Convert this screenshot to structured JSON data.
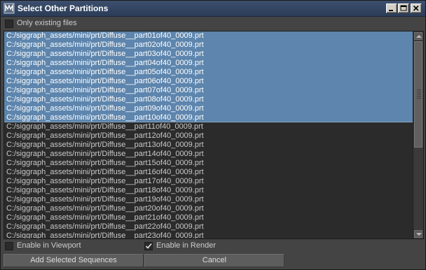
{
  "window": {
    "title": "Select Other Partitions",
    "icon": "maya-app-icon"
  },
  "options": {
    "only_existing_label": "Only existing files",
    "only_existing_checked": false,
    "viewport_label": "Enable in Viewport",
    "viewport_checked": false,
    "render_label": "Enable in Render",
    "render_checked": true
  },
  "files": [
    {
      "path": "C:/siggraph_assets/mini/prt/Diffuse__part01of40_0009.prt",
      "selected": true
    },
    {
      "path": "C:/siggraph_assets/mini/prt/Diffuse__part02of40_0009.prt",
      "selected": true
    },
    {
      "path": "C:/siggraph_assets/mini/prt/Diffuse__part03of40_0009.prt",
      "selected": true
    },
    {
      "path": "C:/siggraph_assets/mini/prt/Diffuse__part04of40_0009.prt",
      "selected": true
    },
    {
      "path": "C:/siggraph_assets/mini/prt/Diffuse__part05of40_0009.prt",
      "selected": true
    },
    {
      "path": "C:/siggraph_assets/mini/prt/Diffuse__part06of40_0009.prt",
      "selected": true
    },
    {
      "path": "C:/siggraph_assets/mini/prt/Diffuse__part07of40_0009.prt",
      "selected": true
    },
    {
      "path": "C:/siggraph_assets/mini/prt/Diffuse__part08of40_0009.prt",
      "selected": true
    },
    {
      "path": "C:/siggraph_assets/mini/prt/Diffuse__part09of40_0009.prt",
      "selected": true
    },
    {
      "path": "C:/siggraph_assets/mini/prt/Diffuse__part10of40_0009.prt",
      "selected": true
    },
    {
      "path": "C:/siggraph_assets/mini/prt/Diffuse__part11of40_0009.prt",
      "selected": false
    },
    {
      "path": "C:/siggraph_assets/mini/prt/Diffuse__part12of40_0009.prt",
      "selected": false
    },
    {
      "path": "C:/siggraph_assets/mini/prt/Diffuse__part13of40_0009.prt",
      "selected": false
    },
    {
      "path": "C:/siggraph_assets/mini/prt/Diffuse__part14of40_0009.prt",
      "selected": false
    },
    {
      "path": "C:/siggraph_assets/mini/prt/Diffuse__part15of40_0009.prt",
      "selected": false
    },
    {
      "path": "C:/siggraph_assets/mini/prt/Diffuse__part16of40_0009.prt",
      "selected": false
    },
    {
      "path": "C:/siggraph_assets/mini/prt/Diffuse__part17of40_0009.prt",
      "selected": false
    },
    {
      "path": "C:/siggraph_assets/mini/prt/Diffuse__part18of40_0009.prt",
      "selected": false
    },
    {
      "path": "C:/siggraph_assets/mini/prt/Diffuse__part19of40_0009.prt",
      "selected": false
    },
    {
      "path": "C:/siggraph_assets/mini/prt/Diffuse__part20of40_0009.prt",
      "selected": false
    },
    {
      "path": "C:/siggraph_assets/mini/prt/Diffuse__part21of40_0009.prt",
      "selected": false
    },
    {
      "path": "C:/siggraph_assets/mini/prt/Diffuse__part22of40_0009.prt",
      "selected": false
    },
    {
      "path": "C:/siggraph_assets/mini/prt/Diffuse__part23of40_0009.prt",
      "selected": false
    }
  ],
  "buttons": {
    "add_label": "Add Selected Sequences",
    "cancel_label": "Cancel"
  },
  "colors": {
    "selection": "#5d85ad",
    "background": "#444444",
    "list_background": "#2b2b2b"
  }
}
